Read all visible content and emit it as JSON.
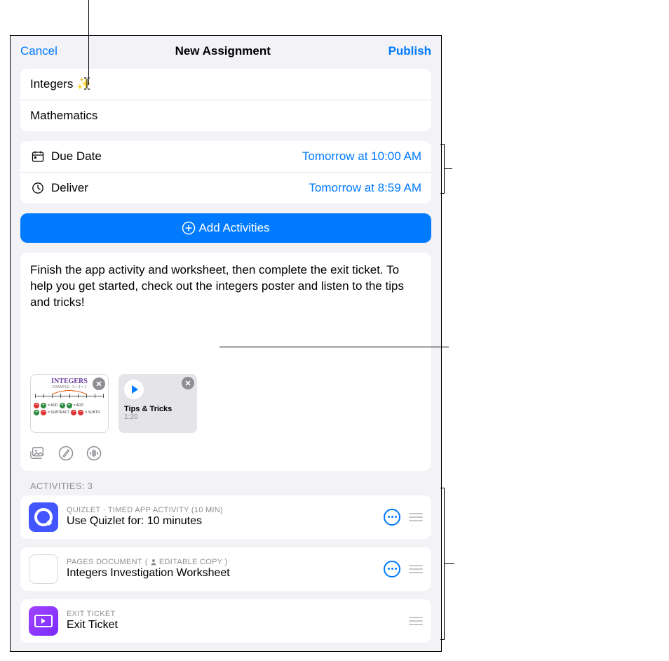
{
  "nav": {
    "cancel": "Cancel",
    "title": "New Assignment",
    "publish": "Publish"
  },
  "fields": {
    "title": "Integers ✨",
    "class": "Mathematics"
  },
  "schedule": {
    "due_label": "Due Date",
    "due_value": "Tomorrow at 10:00 AM",
    "deliver_label": "Deliver",
    "deliver_value": "Tomorrow at 8:59 AM"
  },
  "add_activities_button": "Add Activities",
  "description": "Finish the app activity and worksheet, then complete the exit ticket. To help you get started, check out the integers poster and listen to the tips and tricks!",
  "attachments": {
    "poster_title": "INTEGERS",
    "audio_title": "Tips & Tricks",
    "audio_duration": "1:20"
  },
  "activities_header": "ACTIVITIES: 3",
  "activities": [
    {
      "meta": "QUIZLET · TIMED APP ACTIVITY (10 MIN)",
      "title": "Use Quizlet for: 10 minutes",
      "show_more": true,
      "badge": null
    },
    {
      "meta": "PAGES DOCUMENT",
      "badge": "EDITABLE COPY",
      "title": "Integers Investigation Worksheet",
      "show_more": true
    },
    {
      "meta": "EXIT TICKET",
      "badge": null,
      "title": "Exit Ticket",
      "show_more": false
    }
  ]
}
